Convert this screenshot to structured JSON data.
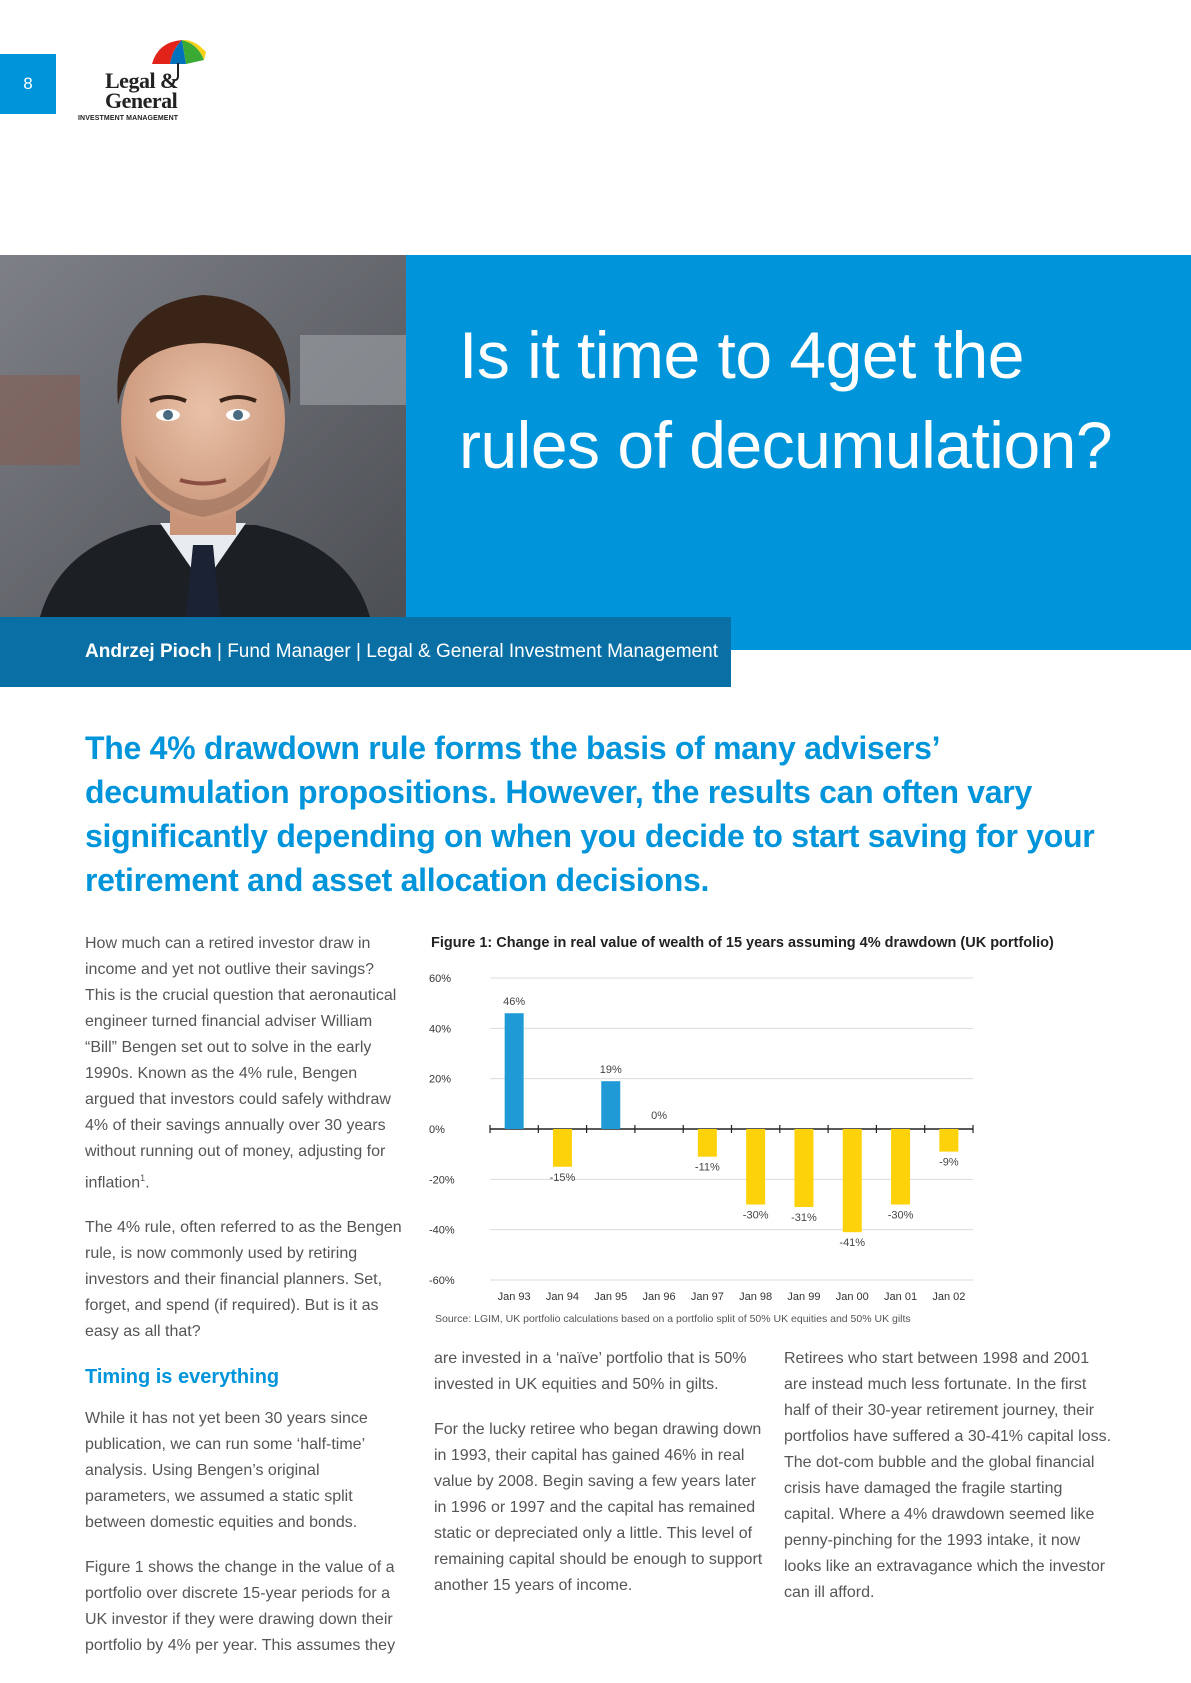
{
  "page_number": "8",
  "logo": {
    "line1": "Legal &",
    "line2": "General",
    "line3": "INVESTMENT MANAGEMENT"
  },
  "title": "Is it time to 4get the rules of decumulation?",
  "byline": {
    "name": "Andrzej Pioch",
    "separator": " | ",
    "role": "Fund Manager",
    "company": "Legal & General Investment Management"
  },
  "standfirst": "The 4% drawdown rule forms the basis of many advisers’ decumulation propositions. However, the results can often vary significantly depending on when you decide to start saving for your retirement and asset allocation decisions.",
  "column1": {
    "p1": "How much can a retired investor draw in income and yet not outlive their savings? This is the crucial question that aeronautical engineer turned financial adviser William “Bill” Bengen set out to solve in the early 1990s. Known as the 4% rule, Bengen argued that investors could safely withdraw 4% of their savings annually over 30 years without running out of money, adjusting for inflation",
    "p1_sup": "1",
    "p1_end": ".",
    "p2": "The 4% rule, often referred to as the Bengen rule, is now commonly used by retiring investors and their financial planners. Set, forget, and spend (if required). But is it as easy as all that?",
    "heading": "Timing is everything",
    "p3": "While it has not yet been 30 years since publication, we can run some ‘half-time’ analysis. Using Bengen’s original parameters, we assumed a static split between domestic equities and bonds.",
    "p4": "Figure 1 shows the change in the value of a portfolio over discrete 15-year periods for a UK investor if they were drawing down their portfolio by 4% per year. This assumes they"
  },
  "column2": {
    "p1": "are invested in a ‘naïve’ portfolio that is 50% invested in UK equities and 50% in gilts.",
    "p2": "For the lucky retiree who began drawing down in 1993, their capital has gained 46% in real value by 2008. Begin saving a few years later in 1996 or 1997 and the capital has remained static or depreciated only a little. This level of remaining capital should be enough to support another 15 years of income."
  },
  "column3": {
    "p1": "Retirees who start between 1998 and 2001 are instead much less fortunate. In the first half of their 30-year retirement journey, their portfolios have suffered a 30-41% capital loss. The dot-com bubble and the global financial crisis have damaged the fragile starting capital. Where a 4% drawdown seemed like penny-pinching for the 1993 intake, it now looks like an extravagance which the investor can ill afford."
  },
  "figure": {
    "title": "Figure 1: Change in real value of wealth of 15 years assuming 4% drawdown (UK portfolio)",
    "source": "Source: LGIM, UK portfolio calculations based on a portfolio split of 50% UK equities and 50% UK gilts"
  },
  "chart_data": {
    "type": "bar",
    "categories": [
      "Jan 93",
      "Jan 94",
      "Jan 95",
      "Jan 96",
      "Jan 97",
      "Jan 98",
      "Jan 99",
      "Jan 00",
      "Jan 01",
      "Jan 02"
    ],
    "values": [
      46,
      -15,
      19,
      0,
      -11,
      -30,
      -31,
      -41,
      -30,
      -9
    ],
    "labels": [
      "46%",
      "-15%",
      "19%",
      "0%",
      "-11%",
      "-30%",
      "-31%",
      "-41%",
      "-30%",
      "-9%"
    ],
    "y_ticks": [
      60,
      40,
      20,
      0,
      -20,
      -40,
      -60
    ],
    "y_tick_labels": [
      "60%",
      "40%",
      "20%",
      "0%",
      "-20%",
      "-40%",
      "-60%"
    ],
    "ylim": [
      -60,
      60
    ],
    "grid": true,
    "colors": {
      "positive": "#1f9ad6",
      "negative": "#fdd20a"
    }
  }
}
